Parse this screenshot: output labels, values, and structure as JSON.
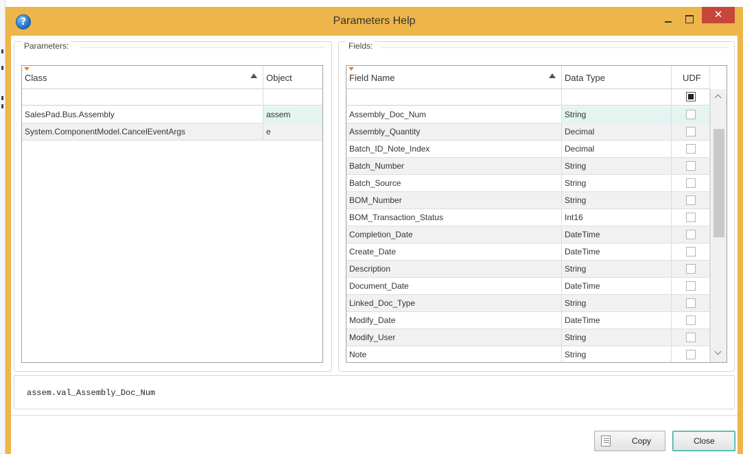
{
  "window": {
    "title": "Parameters Help",
    "close_glyph": "✕",
    "help_glyph": "?"
  },
  "parameters": {
    "label": "Parameters:",
    "columns": [
      "Class",
      "Object"
    ],
    "rows": [
      {
        "class": "SalesPad.Bus.Assembly",
        "object": "assem"
      },
      {
        "class": "System.ComponentModel.CancelEventArgs",
        "object": "e"
      }
    ]
  },
  "fields": {
    "label": "Fields:",
    "columns": [
      "Field Name",
      "Data Type",
      "UDF"
    ],
    "rows": [
      {
        "name": "Assembly_Doc_Num",
        "type": "String"
      },
      {
        "name": "Assembly_Quantity",
        "type": "Decimal"
      },
      {
        "name": "Batch_ID_Note_Index",
        "type": "Decimal"
      },
      {
        "name": "Batch_Number",
        "type": "String"
      },
      {
        "name": "Batch_Source",
        "type": "String"
      },
      {
        "name": "BOM_Number",
        "type": "String"
      },
      {
        "name": "BOM_Transaction_Status",
        "type": "Int16"
      },
      {
        "name": "Completion_Date",
        "type": "DateTime"
      },
      {
        "name": "Create_Date",
        "type": "DateTime"
      },
      {
        "name": "Description",
        "type": "String"
      },
      {
        "name": "Document_Date",
        "type": "DateTime"
      },
      {
        "name": "Linked_Doc_Type",
        "type": "String"
      },
      {
        "name": "Modify_Date",
        "type": "DateTime"
      },
      {
        "name": "Modify_User",
        "type": "String"
      },
      {
        "name": "Note",
        "type": "String"
      }
    ]
  },
  "expression": {
    "text": "assem.val_Assembly_Doc_Num"
  },
  "buttons": {
    "copy_label": "Copy",
    "close_label": "Close"
  },
  "colors": {
    "title_bar": "#eeb54a",
    "close_button": "#c7463a",
    "selection": "#e3f4f1",
    "focus_border": "#3ba99c"
  }
}
